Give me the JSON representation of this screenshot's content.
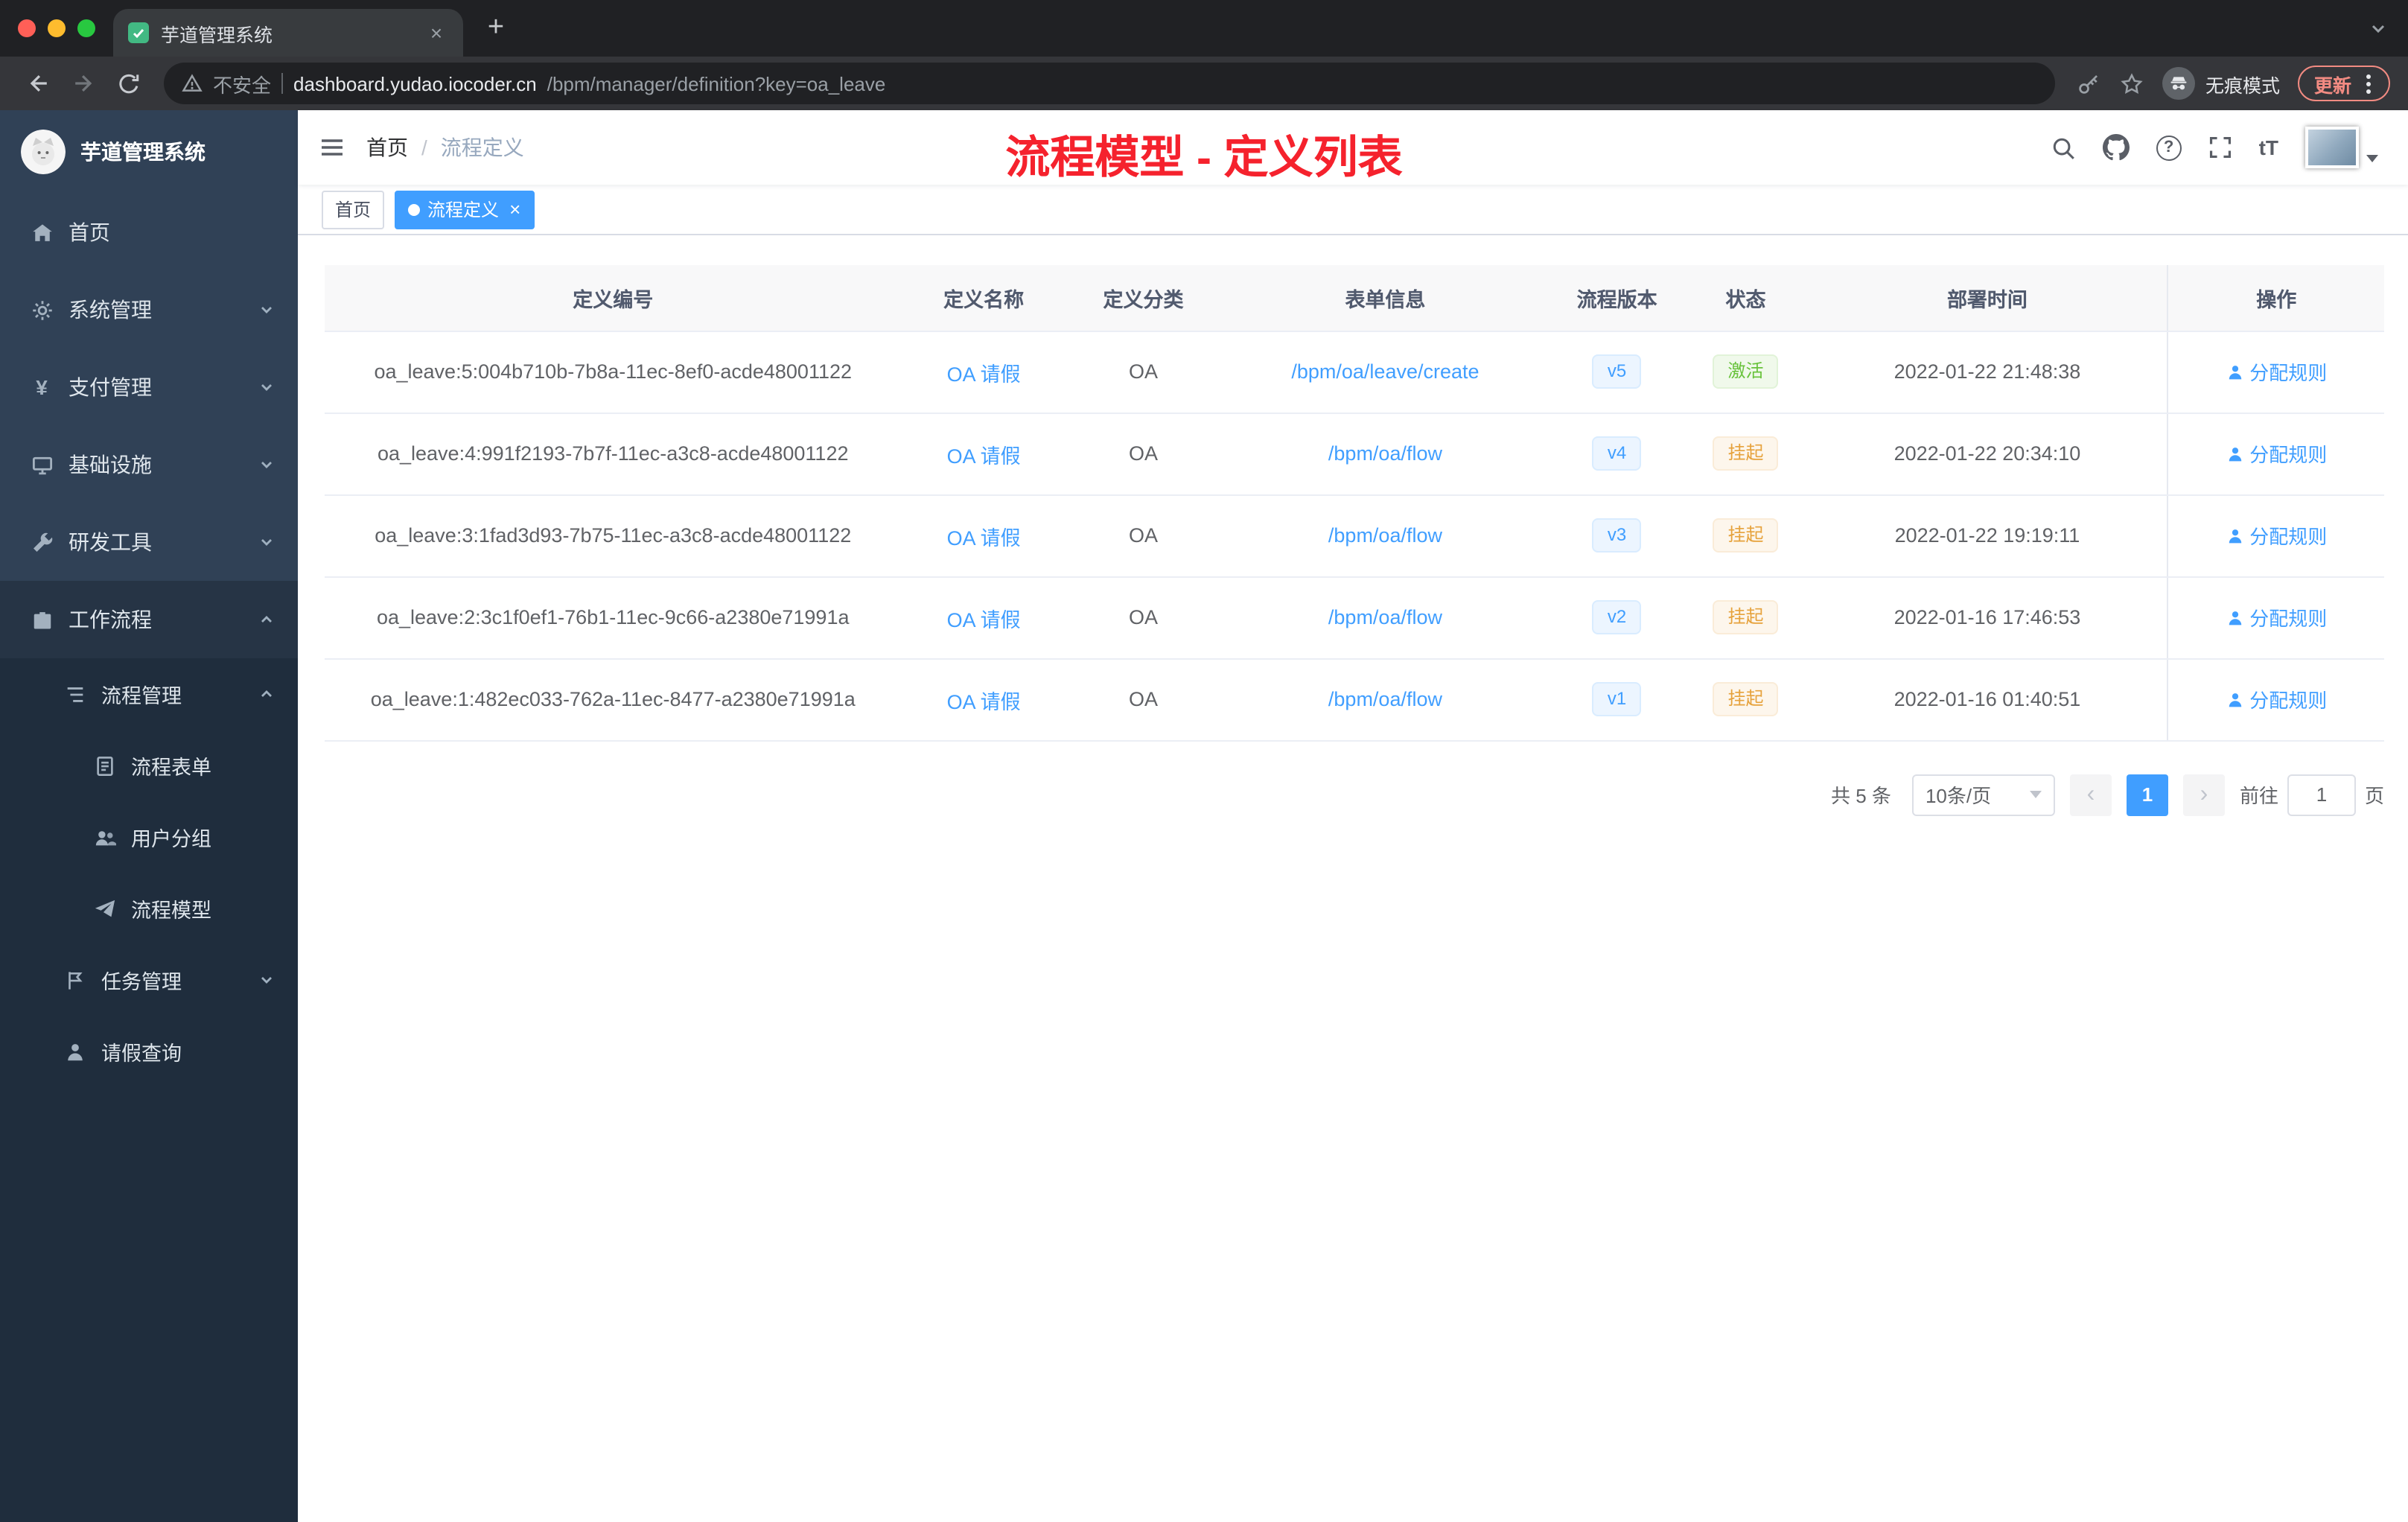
{
  "browser": {
    "tab_title": "芋道管理系统",
    "security_label": "不安全",
    "url_domain": "dashboard.yudao.iocoder.cn",
    "url_path": "/bpm/manager/definition?key=oa_leave",
    "incognito_label": "无痕模式",
    "update_label": "更新"
  },
  "icons": {
    "tab_close": "×",
    "new_tab": "+",
    "help": "?",
    "font_size": "tT",
    "breadcrumb_sep": "/",
    "prev": "‹",
    "next": "›",
    "tag_close": "×",
    "yen": "¥"
  },
  "sidebar": {
    "logo_title": "芋道管理系统",
    "items": [
      {
        "key": "home",
        "label": "首页",
        "icon": "home",
        "level": 1
      },
      {
        "key": "system",
        "label": "系统管理",
        "icon": "gear",
        "level": 1,
        "arrow": "down"
      },
      {
        "key": "payment",
        "label": "支付管理",
        "icon": "yen",
        "level": 1,
        "arrow": "down"
      },
      {
        "key": "infra",
        "label": "基础设施",
        "icon": "infra",
        "level": 1,
        "arrow": "down"
      },
      {
        "key": "devtools",
        "label": "研发工具",
        "icon": "tools",
        "level": 1,
        "arrow": "down"
      },
      {
        "key": "workflow",
        "label": "工作流程",
        "icon": "briefcase",
        "level": 1,
        "arrow": "up",
        "highlight": true
      },
      {
        "key": "process-mgmt",
        "label": "流程管理",
        "icon": "tree",
        "level": 2,
        "arrow": "up",
        "dark": true
      },
      {
        "key": "process-form",
        "label": "流程表单",
        "icon": "doc",
        "level": 3,
        "dark": true
      },
      {
        "key": "user-group",
        "label": "用户分组",
        "icon": "users",
        "level": 3,
        "dark": true
      },
      {
        "key": "process-model",
        "label": "流程模型",
        "icon": "plane",
        "level": 3,
        "dark": true
      },
      {
        "key": "task-mgmt",
        "label": "任务管理",
        "icon": "flag",
        "level": 2,
        "arrow": "down",
        "dark": true
      },
      {
        "key": "leave-query",
        "label": "请假查询",
        "icon": "person",
        "level": 2,
        "dark": true
      }
    ]
  },
  "header": {
    "breadcrumb_home": "首页",
    "breadcrumb_current": "流程定义",
    "overlay_title": "流程模型 - 定义列表",
    "overlay_color": "#f5222d"
  },
  "tags": [
    {
      "label": "首页",
      "active": false,
      "closable": false
    },
    {
      "label": "流程定义",
      "active": true,
      "closable": true
    }
  ],
  "table": {
    "columns": [
      "定义编号",
      "定义名称",
      "定义分类",
      "表单信息",
      "流程版本",
      "状态",
      "部署时间",
      "操作"
    ],
    "rows": [
      {
        "id": "oa_leave:5:004b710b-7b8a-11ec-8ef0-acde48001122",
        "name": "OA 请假",
        "category": "OA",
        "form": "/bpm/oa/leave/create",
        "version": "v5",
        "status": "激活",
        "status_type": "success",
        "deploy_time": "2022-01-22 21:48:38",
        "action": "分配规则"
      },
      {
        "id": "oa_leave:4:991f2193-7b7f-11ec-a3c8-acde48001122",
        "name": "OA 请假",
        "category": "OA",
        "form": "/bpm/oa/flow",
        "version": "v4",
        "status": "挂起",
        "status_type": "warning",
        "deploy_time": "2022-01-22 20:34:10",
        "action": "分配规则"
      },
      {
        "id": "oa_leave:3:1fad3d93-7b75-11ec-a3c8-acde48001122",
        "name": "OA 请假",
        "category": "OA",
        "form": "/bpm/oa/flow",
        "version": "v3",
        "status": "挂起",
        "status_type": "warning",
        "deploy_time": "2022-01-22 19:19:11",
        "action": "分配规则"
      },
      {
        "id": "oa_leave:2:3c1f0ef1-76b1-11ec-9c66-a2380e71991a",
        "name": "OA 请假",
        "category": "OA",
        "form": "/bpm/oa/flow",
        "version": "v2",
        "status": "挂起",
        "status_type": "warning",
        "deploy_time": "2022-01-16 17:46:53",
        "action": "分配规则"
      },
      {
        "id": "oa_leave:1:482ec033-762a-11ec-8477-a2380e71991a",
        "name": "OA 请假",
        "category": "OA",
        "form": "/bpm/oa/flow",
        "version": "v1",
        "status": "挂起",
        "status_type": "warning",
        "deploy_time": "2022-01-16 01:40:51",
        "action": "分配规则"
      }
    ]
  },
  "pagination": {
    "total": "共 5 条",
    "page_size": "10条/页",
    "current_page": "1",
    "goto_label": "前往",
    "goto_value": "1",
    "goto_suffix": "页"
  },
  "colors": {
    "accent": "#409eff",
    "success_text": "#67c23a",
    "warning_text": "#e6a23c",
    "sidebar_bg": "#304156",
    "submenu_bg": "#1f2d3d"
  }
}
